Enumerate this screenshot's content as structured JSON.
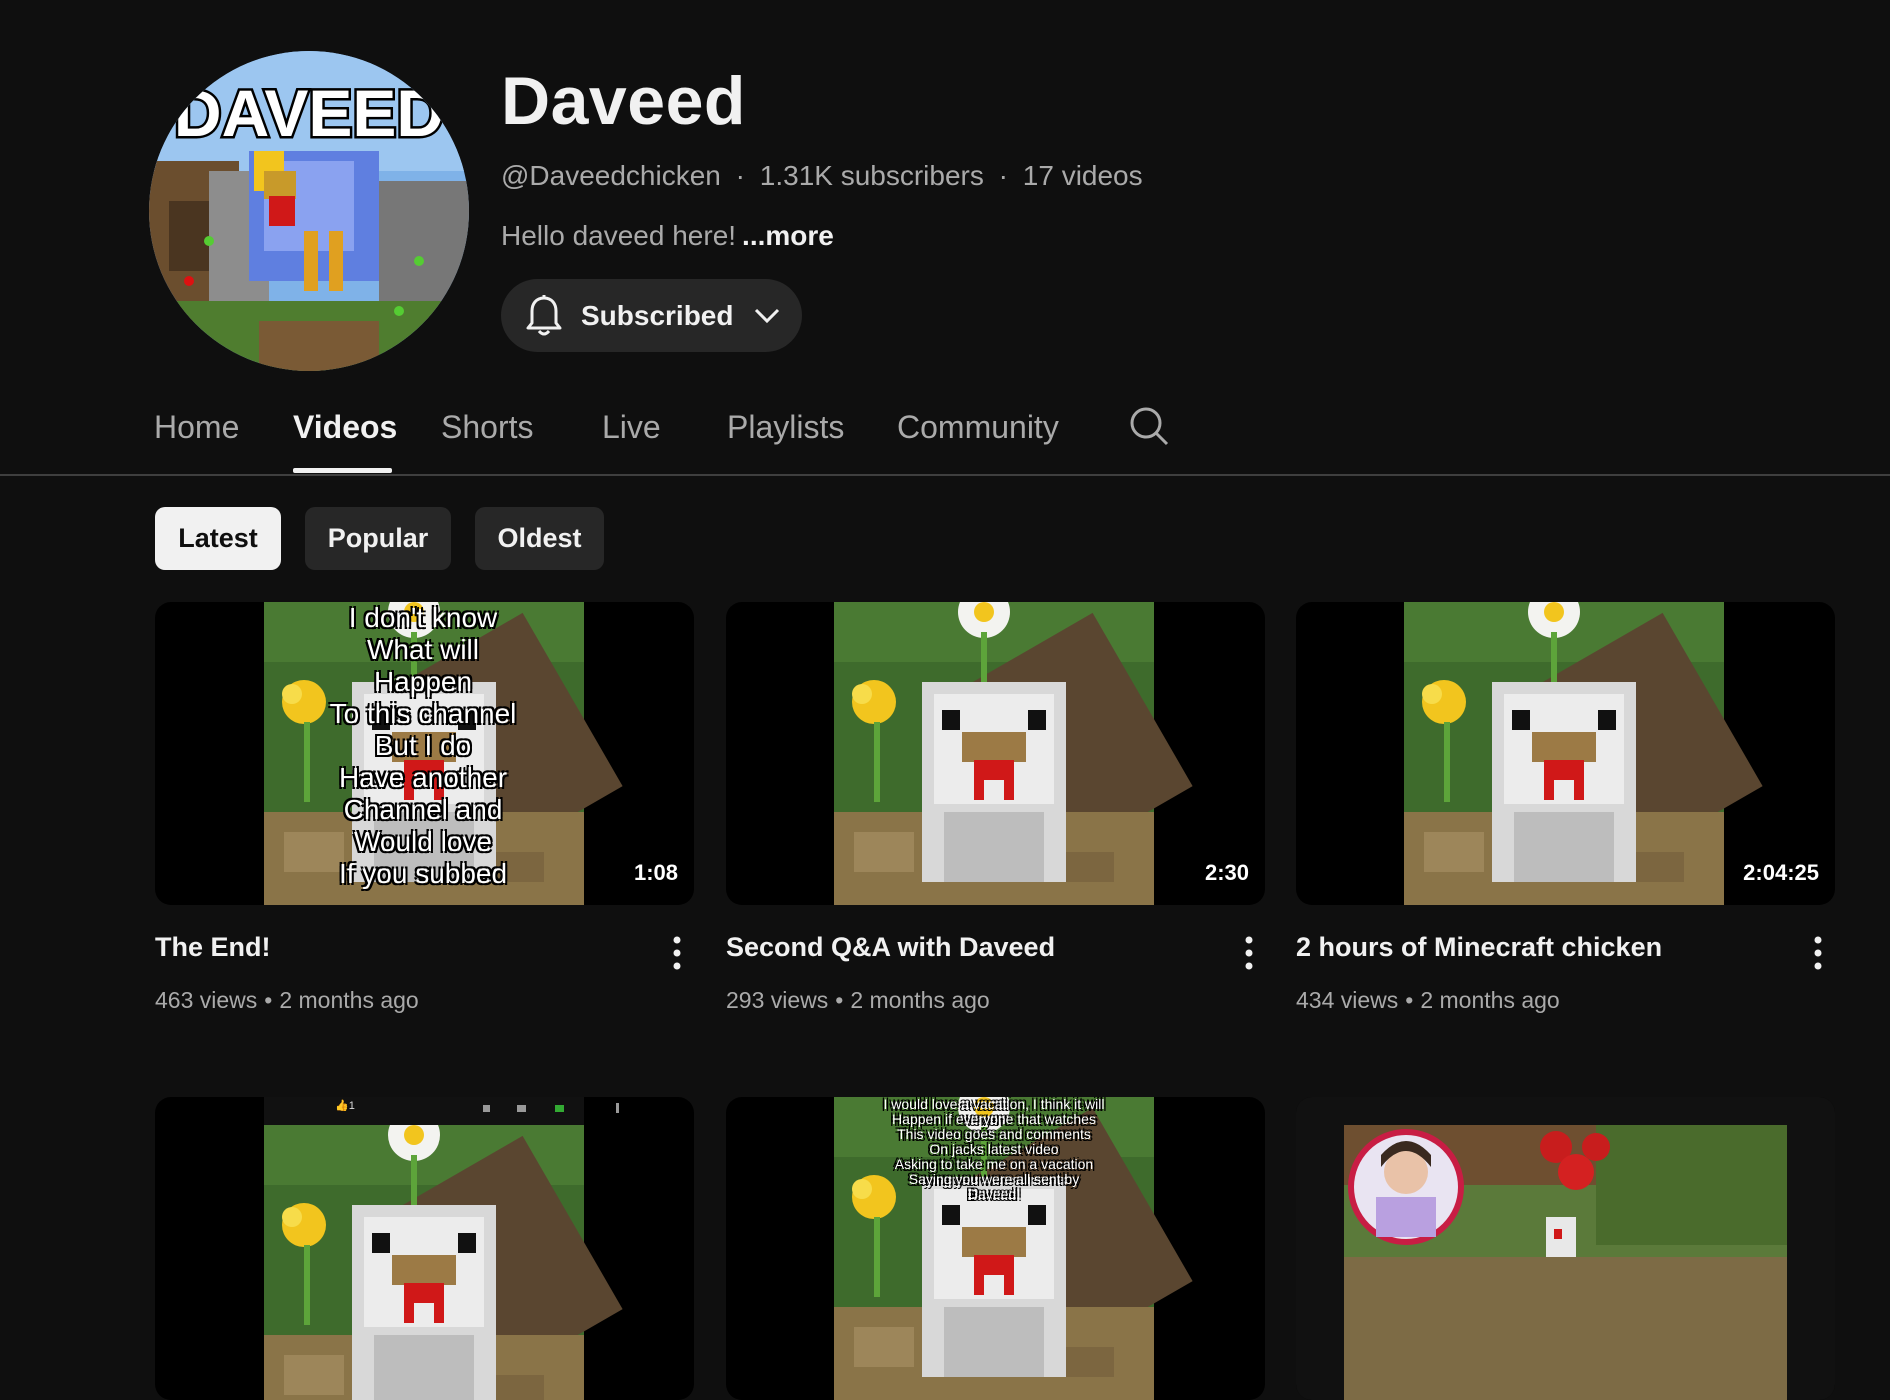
{
  "channel": {
    "name": "Daveed",
    "avatar_text": "DAVEED",
    "handle": "@Daveedchicken",
    "subscribers": "1.31K subscribers",
    "video_count": "17 videos",
    "meta_separator": "·",
    "description": "Hello daveed here!",
    "more_label": "...more",
    "subscribe_label": "Subscribed"
  },
  "tabs": [
    {
      "label": "Home"
    },
    {
      "label": "Videos",
      "active": true
    },
    {
      "label": "Shorts"
    },
    {
      "label": "Live"
    },
    {
      "label": "Playlists"
    },
    {
      "label": "Community"
    }
  ],
  "chips": [
    {
      "label": "Latest",
      "active": true
    },
    {
      "label": "Popular"
    },
    {
      "label": "Oldest"
    }
  ],
  "videos": [
    {
      "title": "The End!",
      "views": "463 views",
      "age": "2 months ago",
      "duration": "1:08",
      "overlay_lines": [
        "I don't know",
        "What will",
        "Happen",
        "To this channel",
        "But I do",
        "Have another",
        "Channel and",
        "Would love",
        "If you subbed"
      ]
    },
    {
      "title": "Second Q&A with Daveed",
      "views": "293 views",
      "age": "2 months ago",
      "duration": "2:30"
    },
    {
      "title": "2 hours of Minecraft chicken",
      "views": "434 views",
      "age": "2 months ago",
      "duration": "2:04:25"
    },
    {
      "title": "",
      "thumb_icon_row": "1"
    },
    {
      "title": "",
      "overlay_lines": [
        "I would love a vacation, I think it will",
        "Happen if everyone that watches",
        "This video goes and comments",
        "On jacks latest video",
        "Asking to take me on a vacation",
        "Saying you were all sent by",
        "Daveed!"
      ]
    },
    {
      "title": ""
    }
  ],
  "stats_separator": "•",
  "colors": {
    "background": "#0f0f0f",
    "text_primary": "#f1f1f1",
    "text_secondary": "#aaaaaa",
    "chip_bg": "#272727",
    "chip_active_bg": "#f1f1f1"
  },
  "icons": {
    "subscribe": "bell-icon",
    "subscribe_dropdown": "chevron-down-icon",
    "tab_search": "search-icon",
    "video_menu": "more-vert-icon"
  }
}
